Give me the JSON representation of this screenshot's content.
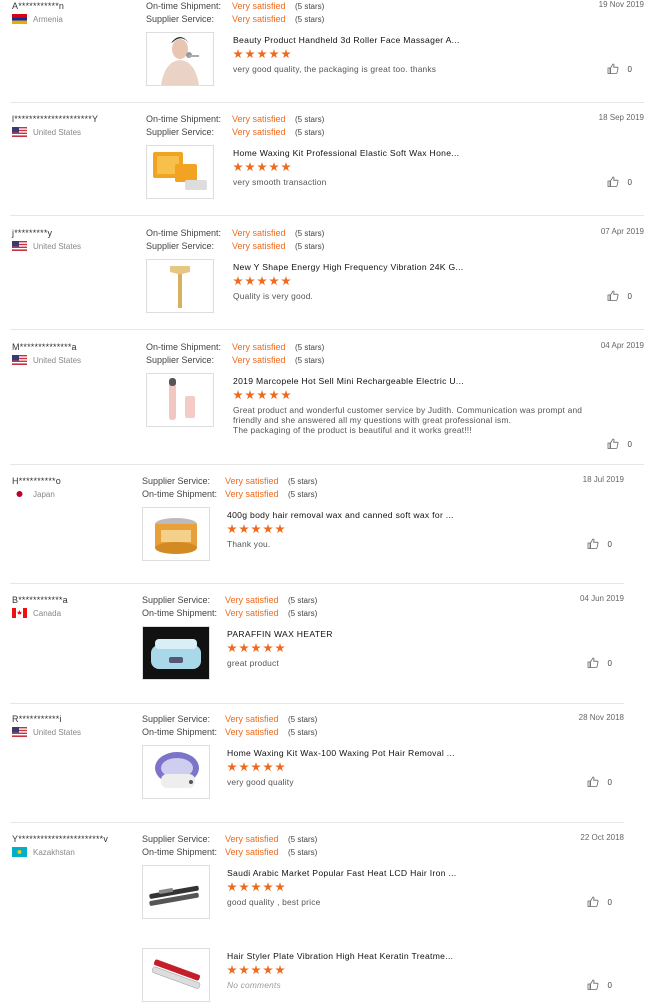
{
  "colors": {
    "accent": "#f06a1d"
  },
  "reviews": [
    {
      "user": "A***********n",
      "country": "Armenia",
      "flag": "flag-armenia-icon",
      "date": "19 Nov 2019",
      "ratings": [
        {
          "label": "On-time Shipment:",
          "value": "Very satisfied",
          "stars": "(5 stars)"
        },
        {
          "label": "Supplier Service:",
          "value": "Very satisfied",
          "stars": "(5 stars)"
        }
      ],
      "product": "Beauty Product Handheld 3d Roller Face Massager A...",
      "comment": "very good quality, the packaging is great too. thanks",
      "likes": "0",
      "image": "face-massager-image"
    },
    {
      "user": "l*********************Y",
      "country": "United States",
      "flag": "flag-us-icon",
      "date": "18 Sep 2019",
      "ratings": [
        {
          "label": "On-time Shipment:",
          "value": "Very satisfied",
          "stars": "(5 stars)"
        },
        {
          "label": "Supplier Service:",
          "value": "Very satisfied",
          "stars": "(5 stars)"
        }
      ],
      "product": "Home Waxing Kit Professional Elastic Soft Wax Hone...",
      "comment": "very smooth transaction",
      "likes": "0",
      "image": "wax-kit-image"
    },
    {
      "user": "j*********y",
      "country": "United States",
      "flag": "flag-us-icon",
      "date": "07 Apr 2019",
      "ratings": [
        {
          "label": "On-time Shipment:",
          "value": "Very satisfied",
          "stars": "(5 stars)"
        },
        {
          "label": "Supplier Service:",
          "value": "Very satisfied",
          "stars": "(5 stars)"
        }
      ],
      "product": "New Y Shape Energy High Frequency Vibration 24K G...",
      "comment": "Quality is very good.",
      "likes": "0",
      "image": "gold-bar-massager-image"
    },
    {
      "user": "M**************a",
      "country": "United States",
      "flag": "flag-us-icon",
      "date": "04 Apr 2019",
      "ratings": [
        {
          "label": "On-time Shipment:",
          "value": "Very satisfied",
          "stars": "(5 stars)"
        },
        {
          "label": "Supplier Service:",
          "value": "Very satisfied",
          "stars": "(5 stars)"
        }
      ],
      "product": "2019 Marcopele Hot Sell Mini Rechargeable Electric U...",
      "comment": "Great product and wonderful customer service by Judith. Communication was prompt and friendly and she answered all my questions with great professional ism.\nThe packaging of the product is beautiful and it works great!!!",
      "likes": "0",
      "image": "pink-device-image"
    },
    {
      "user": "H**********o",
      "country": "Japan",
      "flag": "flag-japan-icon",
      "date": "18 Jul 2019",
      "ratings": [
        {
          "label": "Supplier Service:",
          "value": "Very satisfied",
          "stars": "(5 stars)"
        },
        {
          "label": "On-time Shipment:",
          "value": "Very satisfied",
          "stars": "(5 stars)"
        }
      ],
      "product": "400g body hair removal wax and canned soft wax for ...",
      "comment": "Thank you.",
      "likes": "0",
      "image": "wax-can-image"
    },
    {
      "user": "B************a",
      "country": "Canada",
      "flag": "flag-canada-icon",
      "date": "04 Jun 2019",
      "ratings": [
        {
          "label": "Supplier Service:",
          "value": "Very satisfied",
          "stars": "(5 stars)"
        },
        {
          "label": "On-time Shipment:",
          "value": "Very satisfied",
          "stars": "(5 stars)"
        }
      ],
      "product": "PARAFFIN WAX HEATER",
      "comment": "great product",
      "likes": "0",
      "image": "paraffin-heater-image"
    },
    {
      "user": "R***********i",
      "country": "United States",
      "flag": "flag-us-icon",
      "date": "28 Nov 2018",
      "ratings": [
        {
          "label": "Supplier Service:",
          "value": "Very satisfied",
          "stars": "(5 stars)"
        },
        {
          "label": "On-time Shipment:",
          "value": "Very satisfied",
          "stars": "(5 stars)"
        }
      ],
      "product": "Home Waxing Kit Wax-100 Waxing Pot Hair Removal ...",
      "comment": "very good quality",
      "likes": "0",
      "image": "wax-pot-image"
    },
    {
      "user": "Y***********************v",
      "country": "Kazakhstan",
      "flag": "flag-kazakhstan-icon",
      "date": "22 Oct 2018",
      "ratings": [
        {
          "label": "Supplier Service:",
          "value": "Very satisfied",
          "stars": "(5 stars)"
        },
        {
          "label": "On-time Shipment:",
          "value": "Very satisfied",
          "stars": "(5 stars)"
        }
      ],
      "product": "Saudi Arabic Market Popular Fast Heat LCD Hair Iron ...",
      "comment": "good quality , best price",
      "likes": "0",
      "image": "hair-iron-image",
      "extra": {
        "product": "Hair Styler Plate Vibration High Heat Keratin Treatme...",
        "comment": "No comments",
        "likes": "0",
        "image": "hair-styler-image"
      }
    }
  ]
}
